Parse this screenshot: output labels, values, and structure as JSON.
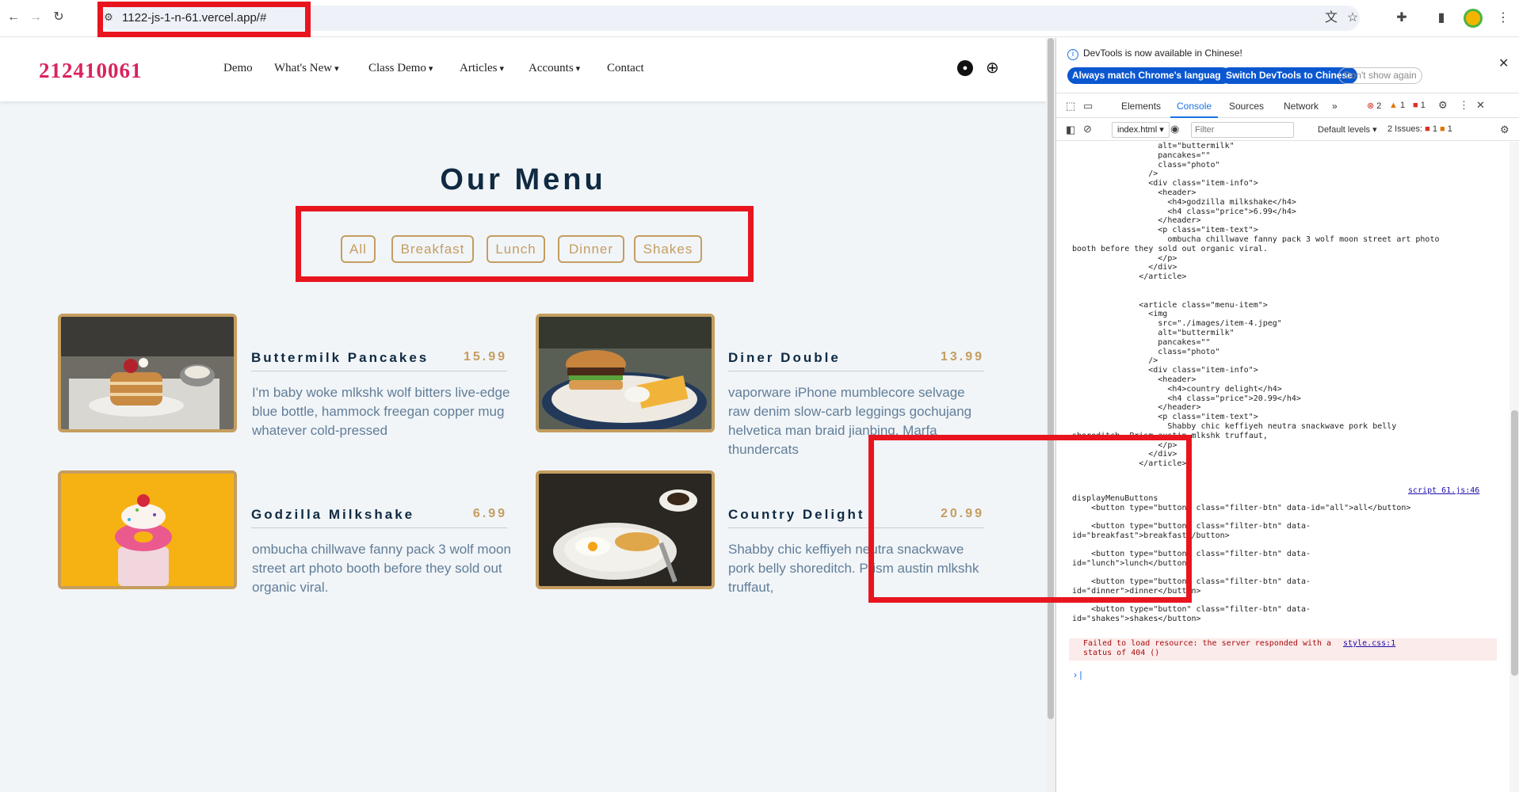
{
  "browser": {
    "url": "1122-js-1-n-61.vercel.app/#"
  },
  "site": {
    "brand": "212410061",
    "nav": [
      {
        "label": "Demo"
      },
      {
        "label": "What's New"
      },
      {
        "label": "Class Demo"
      },
      {
        "label": "Articles"
      },
      {
        "label": "Accounts"
      },
      {
        "label": "Contact"
      }
    ]
  },
  "menu": {
    "title": "Our Menu",
    "filters": [
      "All",
      "Breakfast",
      "Lunch",
      "Dinner",
      "Shakes"
    ],
    "items": [
      {
        "title": "Buttermilk Pancakes",
        "price": "15.99",
        "text": "I'm baby woke mlkshk wolf bitters live-edge blue bottle, hammock freegan copper mug whatever cold-pressed",
        "image": "pancakes-photo"
      },
      {
        "title": "Diner Double",
        "price": "13.99",
        "text": "vaporware iPhone mumblecore selvage raw denim slow-carb leggings gochujang helvetica man braid jianbing. Marfa thundercats",
        "image": "burger-photo"
      },
      {
        "title": "Godzilla Milkshake",
        "price": "6.99",
        "text": "ombucha chillwave fanny pack 3 wolf moon street art photo booth before they sold out organic viral.",
        "image": "milkshake-photo"
      },
      {
        "title": "Country Delight",
        "price": "20.99",
        "text": "Shabby chic keffiyeh neutra snackwave pork belly shoreditch. Prism austin mlkshk truffaut,",
        "image": "breakfast-plate-photo"
      }
    ]
  },
  "devtools": {
    "info": "DevTools is now available in Chinese!",
    "match_lang": "Always match Chrome's language",
    "switch_lang": "Switch DevTools to Chinese",
    "dont_show": "Don't show again",
    "tabs": [
      "Elements",
      "Console",
      "Sources",
      "Network"
    ],
    "counts": {
      "errors": "2",
      "warnings": "1",
      "messages": "1"
    },
    "context": "index.html",
    "filter_placeholder": "Filter",
    "levels": "Default levels",
    "issues_label": "2 Issues:",
    "issues_a": "1",
    "issues_b": "1",
    "code_lines": [
      "      alt=\"buttermilk\"",
      "      pancakes=\"\"",
      "      class=\"photo\"",
      "    />",
      "    <div class=\"item-info\">",
      "      <header>",
      "        <h4>godzilla milkshake</h4>",
      "        <h4 class=\"price\">6.99</h4>",
      "      </header>",
      "      <p class=\"item-text\">",
      "        ombucha chillwave fanny pack 3 wolf moon street art photo",
      "booth before they sold out organic viral.",
      "      </p>",
      "    </div>",
      "  </article>",
      "",
      "",
      "  <article class=\"menu-item\">",
      "    <img",
      "      src=\"./images/item-4.jpeg\"",
      "      alt=\"buttermilk\"",
      "      pancakes=\"\"",
      "      class=\"photo\"",
      "    />",
      "    <div class=\"item-info\">",
      "      <header>",
      "        <h4>country delight</h4>",
      "        <h4 class=\"price\">20.99</h4>",
      "      </header>",
      "      <p class=\"item-text\">",
      "        Shabby chic keffiyeh neutra snackwave pork belly",
      "shoreditch. Prism austin mlkshk truffaut,",
      "      </p>",
      "    </div>",
      "  </article>"
    ],
    "log_lines": [
      "displayMenuButtons",
      "    <button type=\"button\" class=\"filter-btn\" data-id=\"all\">all</button>",
      "",
      "    <button type=\"button\" class=\"filter-btn\" data-",
      "id=\"breakfast\">breakfast</button>",
      "",
      "    <button type=\"button\" class=\"filter-btn\" data-",
      "id=\"lunch\">lunch</button>",
      "",
      "    <button type=\"button\" class=\"filter-btn\" data-",
      "id=\"dinner\">dinner</button>",
      "",
      "    <button type=\"button\" class=\"filter-btn\" data-",
      "id=\"shakes\">shakes</button>"
    ],
    "log_source": "script 61.js:46",
    "error_text": "Failed to load resource: the server responded with a\nstatus of 404 ()",
    "error_source": "style.css:1"
  },
  "colors": {
    "brand": "#d9245d",
    "gold": "#c59d5f",
    "heading": "#102a42",
    "body_text": "#617d98",
    "highlight": "#e8151f",
    "devtools_blue": "#0b57d0"
  }
}
